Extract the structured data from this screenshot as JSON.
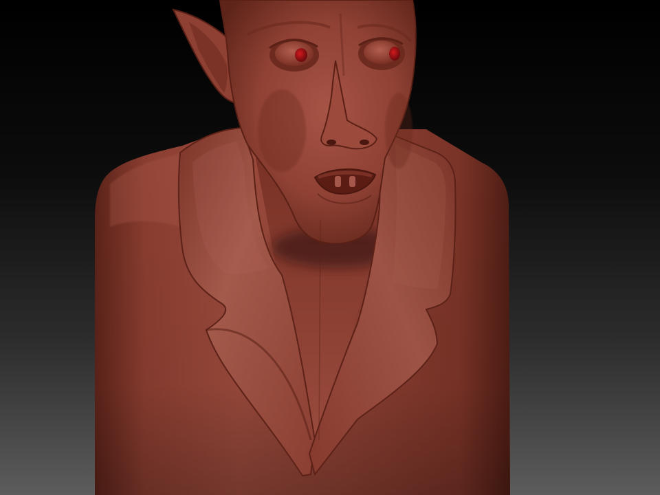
{
  "scene": {
    "subject": "sculpted-bust",
    "material_color": "#8a3a2e",
    "eye_color": "#b0141a",
    "background_top": "#000000",
    "background_bottom": "#5a5a5a"
  }
}
